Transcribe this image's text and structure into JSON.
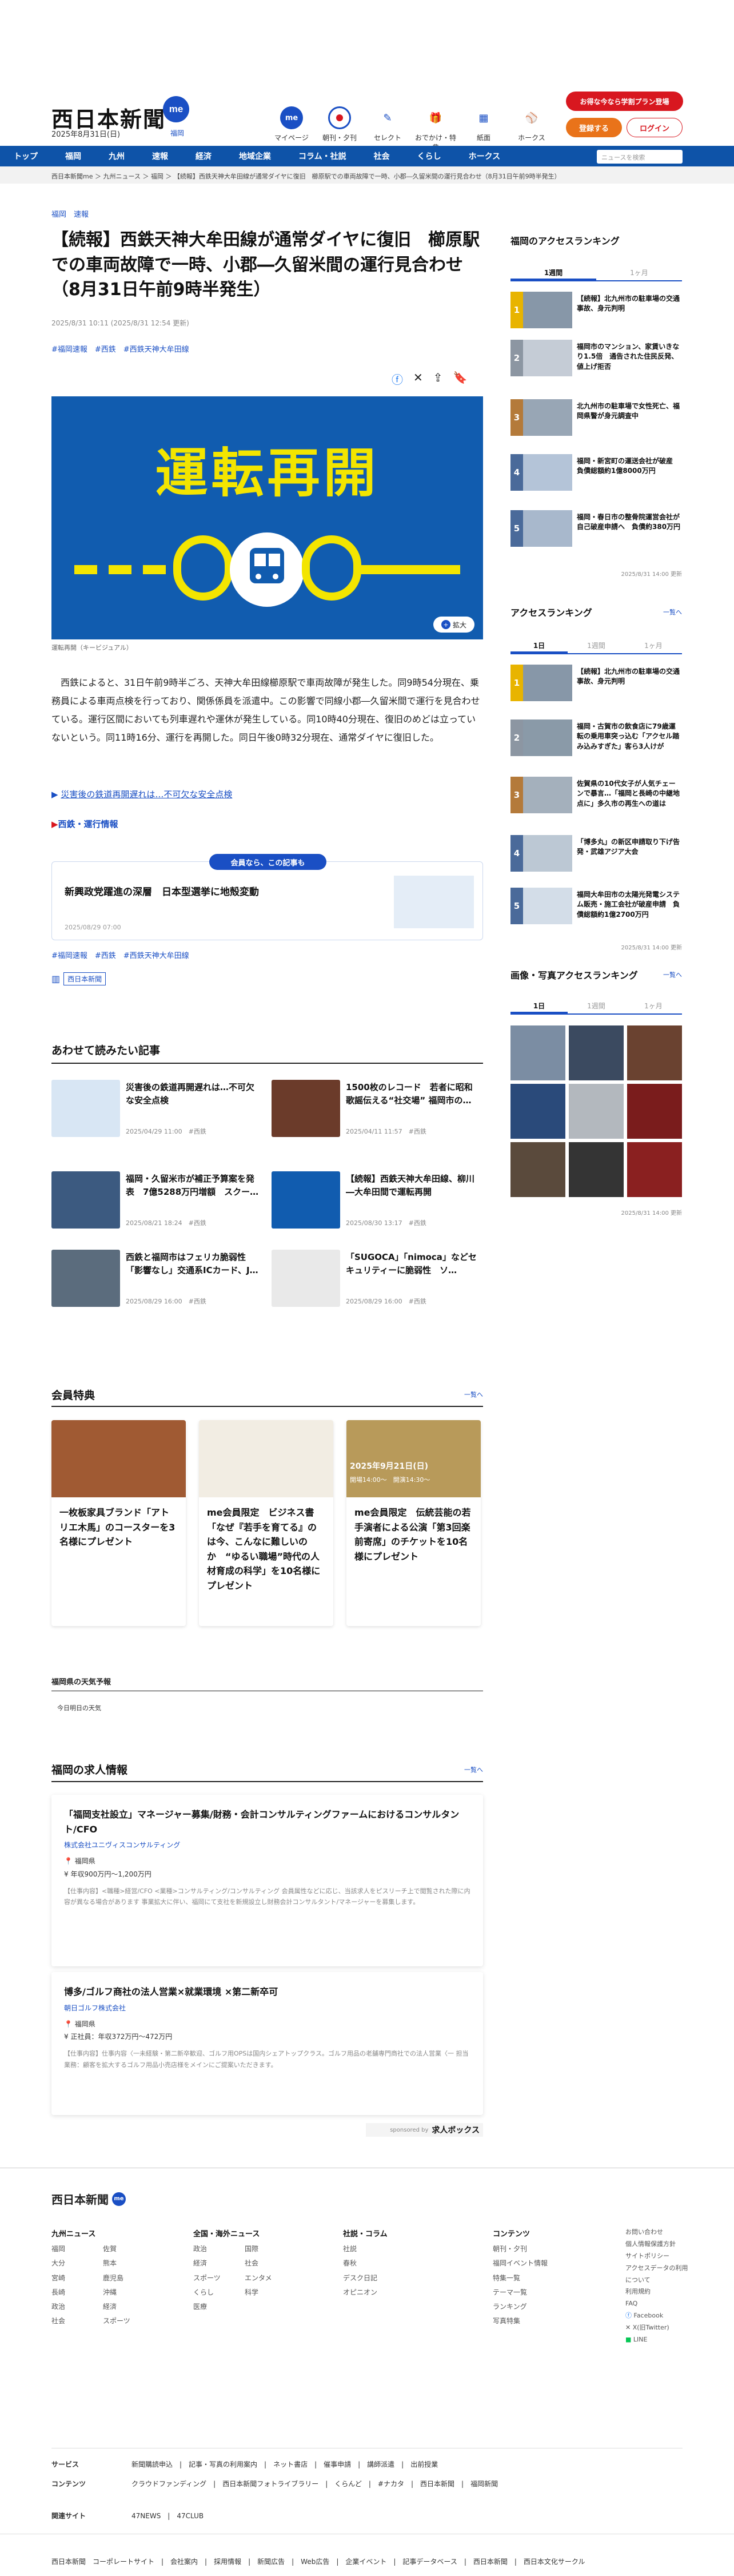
{
  "header": {
    "logo": "西日本新聞",
    "logo_me": "me",
    "date": "2025年8月31日(日)",
    "region": "福岡",
    "icons": [
      {
        "label": "マイページ",
        "icon": "me-icon"
      },
      {
        "label": "朝刊・夕刊",
        "icon": "newspaper-icon"
      },
      {
        "label": "セレクト",
        "icon": "select-icon"
      },
      {
        "label": "おでかけ・特典",
        "icon": "gift-icon"
      },
      {
        "label": "紙面",
        "icon": "paper-icon"
      },
      {
        "label": "ホークス",
        "icon": "hawks-icon"
      }
    ],
    "promo_button": "お得な今なら学割プラン登場",
    "register_button": "登録する",
    "login_button": "ログイン"
  },
  "nav": {
    "items": [
      "トップ",
      "福岡",
      "九州",
      "速報",
      "経済",
      "地域企業",
      "コラム・社説",
      "社会",
      "くらし",
      "ホークス"
    ],
    "search_placeholder": "ニュースを検索"
  },
  "breadcrumb": "西日本新聞me ＞ 九州ニュース ＞ 福岡 ＞ 【続報】西鉄天神大牟田線が通常ダイヤに復旧　櫛原駅での車両故障で一時、小郡―久留米間の運行見合わせ（8月31日午前9時半発生）",
  "article": {
    "tags_top": "福岡　速報",
    "title": "【続報】西鉄天神大牟田線が通常ダイヤに復旧　櫛原駅での車両故障で一時、小郡―久留米間の運行見合わせ　（8月31日午前9時半発生）",
    "pubdate": "2025/8/31 10:11 (2025/8/31 12:54 更新)",
    "tagline": "#福岡速報　#西鉄　#西鉄天神大牟田線",
    "hero_text": "運転再開",
    "zoom": "拡大",
    "caption": "運転再開（キービジュアル）",
    "body": "西鉄によると、31日午前9時半ごろ、天神大牟田線櫛原駅で車両故障が発生した。同9時54分現在、乗務員による車両点検を行っており、関係係員を派遣中。この影響で同線小郡―久留米間で運行を見合わせている。運行区間においても列車遅れや運休が発生している。同10時40分現在、復旧のめどは立っていないという。同11時16分、運行を再開した。同日午後0時32分現在、通常ダイヤに復旧した。",
    "related_link": "災害後の鉄道再開遅れは…不可欠な安全点検",
    "related_section": "西鉄・運行情報",
    "member_badge": "会員なら、この記事も",
    "member_title": "新興政党躍進の深層　日本型選挙に地殻変動",
    "member_date": "2025/08/29 07:00",
    "tags_bottom": "#福岡速報　#西鉄　#西鉄天神大牟田線",
    "source_badge": "西日本新聞"
  },
  "related": {
    "heading": "あわせて読みたい記事",
    "items": [
      {
        "title": "災害後の鉄道再開遅れは…不可欠な安全点検",
        "meta": "2025/04/29 11:00　#西鉄"
      },
      {
        "title": "1500枚のレコード　若者に昭和歌謡伝える“社交場” 福岡市の…",
        "meta": "2025/04/11 11:57　#西鉄"
      },
      {
        "title": "福岡・久留米市が補正予算案を発表　7億5288万円増額　スクー…",
        "meta": "2025/08/21 18:24　#西鉄"
      },
      {
        "title": "【続報】西鉄天神大牟田線、柳川―大牟田間で運転再開",
        "meta": "2025/08/30 13:17　#西鉄"
      },
      {
        "title": "西鉄と福岡市はフェリカ脆弱性「影響なし」交通系ICカード、J…",
        "meta": "2025/08/29 16:00　#西鉄"
      },
      {
        "title": "「SUGOCA」「nimoca」などセキュリティーに脆弱性　ソ…",
        "meta": "2025/08/29 16:00　#西鉄"
      }
    ]
  },
  "perks": {
    "heading": "会員特典",
    "more": "一覧へ",
    "items": [
      {
        "title": "一枚板家具ブランド「アトリエ木馬」のコースターを3名様にプレゼント"
      },
      {
        "title": "me会員限定　ビジネス書「なぜ『若手を育てる』のは今、こんなに難しいのか　“ゆるい職場”時代の人材育成の科学」を10名様にプレゼント"
      },
      {
        "title": "me会員限定　伝統芸能の若手演者による公演「第3回楽前寄席」のチケットを10名様にプレゼント"
      }
    ],
    "event_date": "2025年9月21日(日)",
    "event_time": "開場14:00〜　開演14:30〜"
  },
  "weather": {
    "heading": "福岡県の天気予報",
    "today": "今日明日の天気"
  },
  "jobs": {
    "heading": "福岡の求人情報",
    "more": "一覧へ",
    "items": [
      {
        "title": "「福岡支社設立」マネージャー募集/財務・会計コンサルティングファームにおけるコンサルタント/CFO",
        "company": "株式会社ユニヴィスコンサルティング",
        "place": "福岡県",
        "salary": "年収900万円～1,200万円",
        "desc": "【仕事内容】<職種>経営/CFO <業種>コンサルティング/コンサルティング 会員属性などに応じ、当該求人をピスリーチ上で閲覧された際に内容が異なる場合があります 事業拡大に伴い、福岡にて支社を新規設立し財務会計コンサルタント/マネージャーを募集します。"
      },
      {
        "title": "博多/ゴルフ商社の法人営業×就業環境 ×第二新卒可",
        "company": "朝日ゴルフ株式会社",
        "place": "福岡県",
        "salary": "正社員：年収372万円～472万円",
        "desc": "【仕事内容】仕事内容〈一未経験・第二新卒歓迎、ゴルフ用OPSは国内シェアトップクラス。ゴルフ用品の老舗専門商社での法人営業〈一 担当業務：顧客を拡大するゴルフ用品小売店様をメインにご提案いただきます。"
      }
    ],
    "sponsor": "sponsored by",
    "sponsor_name": "求人ボックス"
  },
  "sidebar": {
    "ranking_heading": "福岡のアクセスランキング",
    "tabs1": [
      "1週間",
      "1ヶ月"
    ],
    "rank1": [
      {
        "n": "1",
        "title": "【続報】北九州市の駐車場の交通事故、身元判明"
      },
      {
        "n": "2",
        "title": "福岡市のマンション、家賃いきなり1.5倍　通告された住民反発、値上げ拒否"
      },
      {
        "n": "3",
        "title": "北九州市の駐車場で女性死亡、福岡県警が身元調査中"
      },
      {
        "n": "4",
        "title": "福岡・新宮町の運送会社が破産　負債総額約1億8000万円"
      },
      {
        "n": "5",
        "title": "福岡・春日市の整骨院運営会社が自己破産申請へ　負債約380万円"
      }
    ],
    "rank1_updated": "2025/8/31 14:00 更新",
    "access_heading": "アクセスランキング",
    "access_more": "一覧へ",
    "tabs2": [
      "1日",
      "1週間",
      "1ヶ月"
    ],
    "rank2": [
      {
        "n": "1",
        "title": "【続報】北九州市の駐車場の交通事故、身元判明"
      },
      {
        "n": "2",
        "title": "福岡・古賀市の飲食店に79歳運転の乗用車突っ込む「アクセル踏み込みすぎた」客ら3人けが"
      },
      {
        "n": "3",
        "title": "佐賀県の10代女子が人気チェーンで暴言…「福岡と長崎の中継地点に」多久市の再生への道は"
      },
      {
        "n": "4",
        "title": "「博多丸」の新区申請取り下げ告発・武雄アジア大会"
      },
      {
        "n": "5",
        "title": "福岡大牟田市の太陽光発電システム販売・施工会社が破産申請　負債総額約1億2700万円"
      }
    ],
    "rank2_updated": "2025/8/31 14:00 更新",
    "photo_heading": "画像・写真アクセスランキング",
    "photo_more": "一覧へ",
    "tabs3": [
      "1日",
      "1週間",
      "1ヶ月"
    ],
    "photo_updated": "2025/8/31 14:00 更新"
  },
  "footer": {
    "logo": "西日本新聞",
    "cols": [
      {
        "h": "九州ニュース",
        "items": [
          "福岡",
          "佐賀",
          "大分",
          "熊本",
          "宮崎",
          "鹿児島",
          "長崎",
          "沖縄",
          "政治",
          "経済",
          "社会",
          "スポーツ"
        ]
      },
      {
        "h": "全国・海外ニュース",
        "items": [
          "政治",
          "国際",
          "経済",
          "社会",
          "スポーツ",
          "エンタメ",
          "くらし",
          "科学",
          "医療"
        ]
      },
      {
        "h": "社説・コラム",
        "items": [
          "社説",
          "春秋",
          "デスク日記",
          "オピニオン"
        ]
      },
      {
        "h": "コンテンツ",
        "items": [
          "朝刊・夕刊",
          "福岡イベント情報",
          "特集一覧",
          "テーマ一覧",
          "ランキング",
          "写真特集"
        ]
      },
      {
        "h": "",
        "items": [
          "お問い合わせ",
          "個人情報保護方針",
          "サイトポリシー",
          "アクセスデータの利用について",
          "利用規約",
          "FAQ",
          "Facebook",
          "X(旧Twitter)",
          "LINE"
        ]
      }
    ],
    "service_label": "サービス",
    "service_items": "新聞購読申込　|　記事・写真の利用案内　|　ネット書店　|　催事申請　|　講師派遣　|　出前授業",
    "content_label": "コンテンツ",
    "content_items": "クラウドファンディング　|　西日本新聞フォトライブラリー　|　くらんど　|　#ナカタ　|　西日本新聞　|　福岡新聞",
    "related_label": "関連サイト",
    "related_items": "47NEWS　|　47CLUB",
    "bottom": "西日本新聞　コーポレートサイト　|　会社案内　|　採用情報　|　新聞広告　|　Web広告　|　企業イベント　|　記事データベース　|　西日本新聞　|　西日本文化サークル"
  },
  "colors": {
    "brand": "#0e53a8",
    "accent_red": "#d8171f",
    "link": "#1a4fc4"
  }
}
